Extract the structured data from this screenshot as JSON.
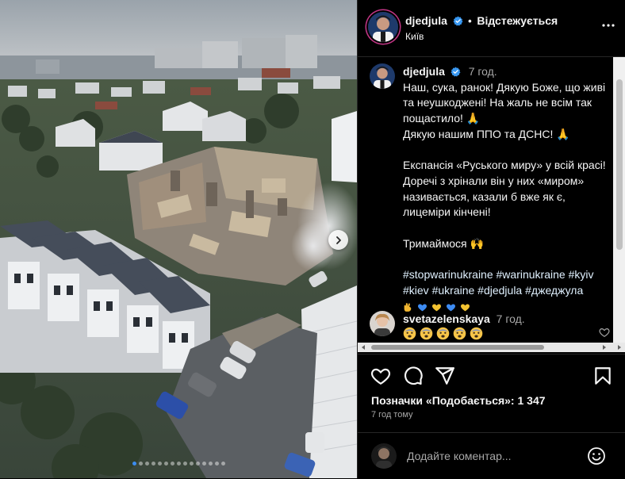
{
  "post": {
    "username": "djedjula",
    "location": "Київ",
    "follow_label": "Відстежується",
    "caption": {
      "time": "7 год.",
      "paragraph1": "Наш, сука, ранок! Дякую Боже, що живі та неушкоджені! На жаль не всім так пощастило! 🙏",
      "paragraph1_line2": "Дякую нашим ППО та ДСНС! 🙏",
      "paragraph2": "Експансія «Руського миру» у всій красі! Доречі з хрінали він у них «миром» називається, казали б вже як є, лицеміри кінчені!",
      "paragraph3": "Тримаймося 🙌",
      "hashtags": [
        "#stopwarinukraine",
        "#warinukraine",
        "#kyiv",
        "#kiev",
        "#ukraine",
        "#djedjula",
        "#джеджула"
      ],
      "emoji_colors": [
        "#f2b731",
        "#3d8bf2",
        "#f2c230",
        "#3d8bf2",
        "#f2c230"
      ]
    },
    "comments": [
      {
        "username": "svetazelenskaya",
        "time": "7 год.",
        "faces": [
          "😨",
          "😨",
          "😨",
          "😨",
          "😨"
        ]
      }
    ],
    "likes_text": "Позначки «Подобається»: 1 347",
    "time_ago": "7 год тому",
    "add_comment_placeholder": "Додайте коментар...",
    "carousel": {
      "slides": 15,
      "active": 0
    }
  },
  "colors": {
    "verified": "#3897f0",
    "accent_link": "#e0f1ff",
    "ring": "#c13584"
  },
  "icons": [
    "verified-badge-icon",
    "more-options-icon",
    "heart-icon",
    "comment-icon",
    "share-icon",
    "save-icon",
    "emoji-icon",
    "chevron-right-icon"
  ]
}
